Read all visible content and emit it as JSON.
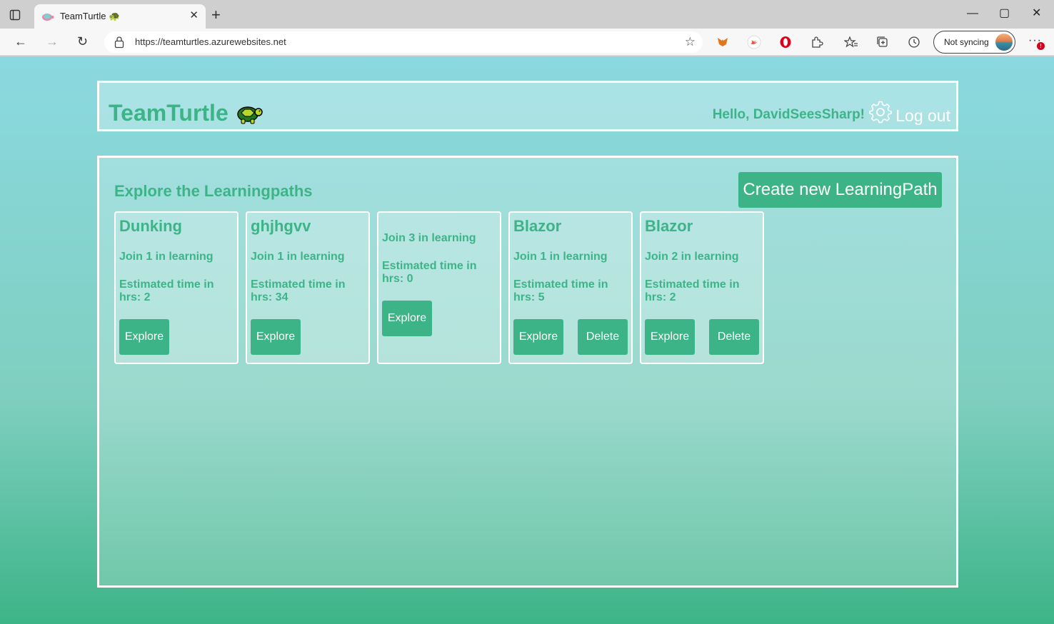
{
  "browser": {
    "tab_title": "TeamTurtle 🐢",
    "url": "https://teamturtles.azurewebsites.net",
    "sync_label": "Not syncing",
    "new_tab": "+",
    "close_tab": "✕",
    "minimize": "—",
    "maximize": "▢",
    "close_window": "✕",
    "back": "←",
    "forward": "→",
    "refresh": "↻",
    "more": "···",
    "more_badge": "!"
  },
  "header": {
    "brand": "TeamTurtle",
    "greeting": "Hello, DavidSeesSharp!",
    "logout": "Log out"
  },
  "main": {
    "section_title": "Explore the Learningpaths",
    "create_button": "Create new LearningPath",
    "cards": [
      {
        "title": "Dunking",
        "join": "Join 1 in learning",
        "estimate": "Estimated time in hrs: 2",
        "explore": "Explore"
      },
      {
        "title": "ghjhgvv",
        "join": "Join 1 in learning",
        "estimate": "Estimated time in hrs: 34",
        "explore": "Explore"
      },
      {
        "title": "",
        "join": "Join 3 in learning",
        "estimate": "Estimated time in hrs: 0",
        "explore": "Explore"
      },
      {
        "title": "Blazor",
        "join": "Join 1 in learning",
        "estimate": "Estimated time in hrs: 5",
        "explore": "Explore",
        "delete": "Delete"
      },
      {
        "title": "Blazor",
        "join": "Join 2 in learning",
        "estimate": "Estimated time in hrs: 2",
        "explore": "Explore",
        "delete": "Delete"
      }
    ]
  },
  "colors": {
    "accent": "#3db488",
    "border": "#ffffff"
  }
}
